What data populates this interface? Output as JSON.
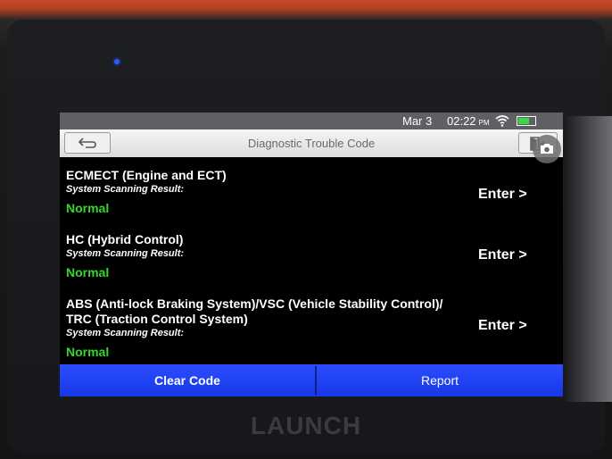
{
  "status": {
    "date": "Mar 3",
    "time": "02:22",
    "ampm": "PM"
  },
  "titlebar": {
    "title": "Diagnostic Trouble Code"
  },
  "systems": [
    {
      "name": "ECMECT (Engine and ECT)",
      "label": "System Scanning Result:",
      "result": "Normal",
      "enter": "Enter >"
    },
    {
      "name": "HC (Hybrid Control)",
      "label": "System Scanning Result:",
      "result": "Normal",
      "enter": "Enter >"
    },
    {
      "name": "ABS (Anti-lock Braking System)/VSC (Vehicle Stability Control)/",
      "name2": "TRC (Traction Control System)",
      "label": "System Scanning Result:",
      "result": "Normal",
      "enter": "Enter >"
    }
  ],
  "buttons": {
    "clear": "Clear Code",
    "report": "Report"
  },
  "brand": "LAUNCH",
  "colors": {
    "accent": "#1f44f2",
    "normal_status": "#35d62f",
    "titlebar": "#e8e8e8"
  },
  "icons": [
    "back-icon",
    "exit-icon",
    "camera-icon",
    "wifi-icon",
    "battery-icon"
  ]
}
